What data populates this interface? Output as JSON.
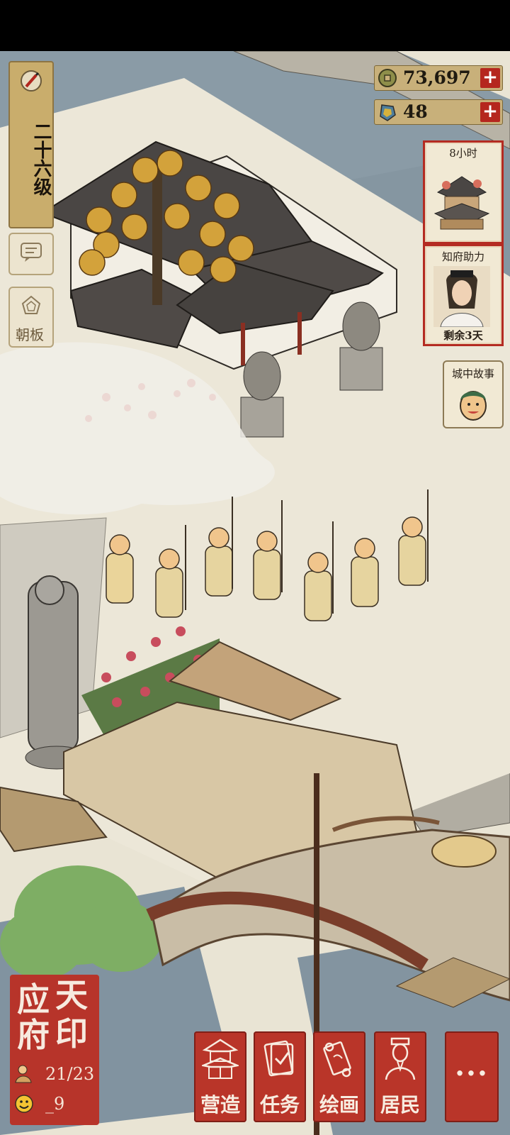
{
  "level": {
    "text": "二十六级"
  },
  "side": {
    "chat_icon": "chat-bubble-icon",
    "board_label": "朝板"
  },
  "currency": [
    {
      "icon": "copper-coin-icon",
      "value": "73,697",
      "plus": "+"
    },
    {
      "icon": "jade-gem-icon",
      "value": "48",
      "plus": "+"
    }
  ],
  "panels": {
    "build_timer": {
      "title": "8小时"
    },
    "helper": {
      "title": "知府助力",
      "subtitle": "剩余3天"
    },
    "story": {
      "title": "城中故事"
    }
  },
  "seal": {
    "chars": [
      "应",
      "天",
      "府",
      "印"
    ],
    "population": "21/23",
    "happiness": "_9"
  },
  "bottom_nav": [
    {
      "label": "营造",
      "icon": "pavilion-icon"
    },
    {
      "label": "任务",
      "icon": "scroll-book-icon"
    },
    {
      "label": "绘画",
      "icon": "painting-scroll-icon"
    },
    {
      "label": "居民",
      "icon": "resident-portrait-icon"
    }
  ],
  "more_label": "···",
  "colors": {
    "accent": "#b93529",
    "parchment": "#e9e4d4",
    "water": "#7f93a0",
    "roof": "#4a4644"
  }
}
